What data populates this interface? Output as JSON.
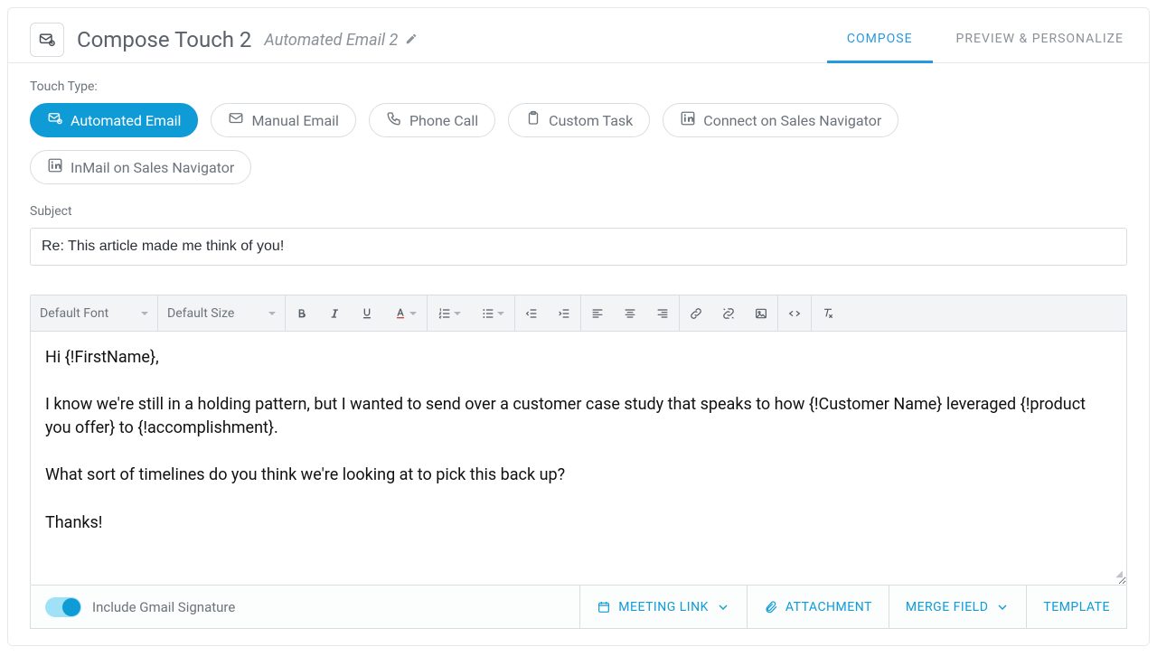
{
  "header": {
    "title": "Compose Touch 2",
    "subtitle": "Automated Email 2",
    "tabs": {
      "compose": "COMPOSE",
      "preview": "PREVIEW & PERSONALIZE"
    }
  },
  "touch_type": {
    "label": "Touch Type:",
    "options": [
      {
        "id": "automated-email",
        "label": "Automated Email",
        "active": true,
        "icon": "mail-auto"
      },
      {
        "id": "manual-email",
        "label": "Manual Email",
        "active": false,
        "icon": "mail"
      },
      {
        "id": "phone-call",
        "label": "Phone Call",
        "active": false,
        "icon": "phone"
      },
      {
        "id": "custom-task",
        "label": "Custom Task",
        "active": false,
        "icon": "clipboard"
      },
      {
        "id": "connect-sn",
        "label": "Connect on Sales Navigator",
        "active": false,
        "icon": "linkedin"
      },
      {
        "id": "inmail-sn",
        "label": "InMail on Sales Navigator",
        "active": false,
        "icon": "linkedin"
      }
    ]
  },
  "subject": {
    "label": "Subject",
    "value": "Re: This article made me think of you!"
  },
  "toolbar": {
    "font_label": "Default Font",
    "size_label": "Default Size"
  },
  "body_lines": [
    "Hi {!FirstName},",
    "",
    "I know we're still in a holding pattern, but I wanted to send over a customer case study that speaks to how {!Customer Name} leveraged {!product you offer} to {!accomplishment}.",
    "",
    "What sort of timelines do you think we're looking at to pick this back up?",
    "",
    "Thanks!"
  ],
  "footer": {
    "signature_label": "Include Gmail Signature",
    "meeting_link": "MEETING LINK",
    "attachment": "ATTACHMENT",
    "merge_field": "MERGE FIELD",
    "template": "TEMPLATE"
  }
}
